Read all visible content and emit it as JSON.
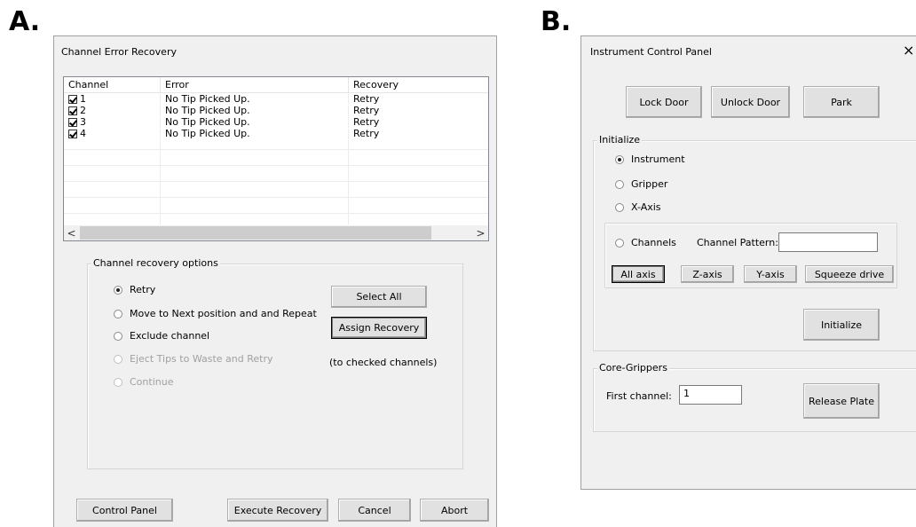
{
  "labels": {
    "a": "A.",
    "b": "B."
  },
  "winA": {
    "title": "Channel Error Recovery",
    "table": {
      "headers": [
        "Channel",
        "Error",
        "Recovery"
      ],
      "rows": [
        {
          "channel": "1",
          "error": "No Tip Picked Up.",
          "recovery": "Retry",
          "checked": true
        },
        {
          "channel": "2",
          "error": "No Tip Picked Up.",
          "recovery": "Retry",
          "checked": true
        },
        {
          "channel": "3",
          "error": "No Tip Picked Up.",
          "recovery": "Retry",
          "checked": true
        },
        {
          "channel": "4",
          "error": "No Tip Picked Up.",
          "recovery": "Retry",
          "checked": true
        }
      ],
      "scroll_left": "<",
      "scroll_right": ">"
    },
    "options": {
      "group_label": "Channel recovery options",
      "retry": "Retry",
      "move_next": "Move to Next position and  and Repeat",
      "exclude": "Exclude channel",
      "eject": "Eject Tips to Waste and Retry",
      "continue": "Continue",
      "select_all": "Select All",
      "assign": "Assign Recovery",
      "to_checked": "(to checked channels)"
    },
    "buttons": {
      "control_panel": "Control Panel",
      "execute": "Execute Recovery",
      "cancel": "Cancel",
      "abort": "Abort"
    }
  },
  "winB": {
    "title": "Instrument Control Panel",
    "close": "×",
    "lock_door": "Lock Door",
    "unlock_door": "Unlock Door",
    "park": "Park",
    "initialize_group": "Initialize",
    "instrument": "Instrument",
    "gripper": "Gripper",
    "x_axis": "X-Axis",
    "channels": "Channels",
    "channel_pattern_label": "Channel Pattern:",
    "channel_pattern_value": "",
    "all_axis": "All axis",
    "z_axis": "Z-axis",
    "y_axis": "Y-axis",
    "squeeze": "Squeeze drive",
    "initialize_btn": "Initialize",
    "core_group": "Core-Grippers",
    "first_channel_label": "First channel:",
    "first_channel_value": "1",
    "release_plate": "Release Plate"
  }
}
